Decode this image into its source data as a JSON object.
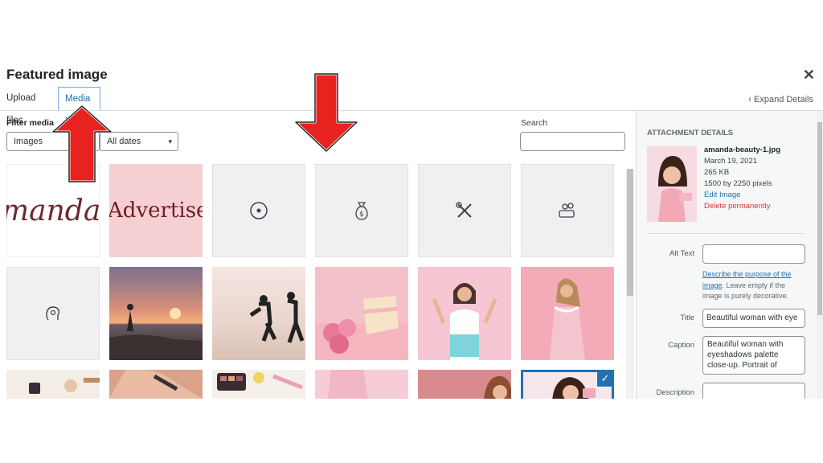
{
  "modal": {
    "title": "Featured image",
    "close_icon": "close-icon",
    "tabs": [
      {
        "label": "Upload files",
        "active": false
      },
      {
        "label": "Media Library",
        "active": true
      }
    ],
    "expand_details": "Expand Details"
  },
  "filters": {
    "label": "Filter media",
    "type_value": "Images",
    "date_value": "All dates",
    "search_label": "Search",
    "search_value": ""
  },
  "grid": {
    "row1": [
      {
        "kind": "image",
        "label": "amanda-logo",
        "text": "manda Ce"
      },
      {
        "kind": "image",
        "label": "advertise-banner",
        "text": "Advertise"
      },
      {
        "kind": "icon",
        "icon": "target-icon"
      },
      {
        "kind": "icon",
        "icon": "money-bag-icon"
      },
      {
        "kind": "icon",
        "icon": "tools-icon"
      },
      {
        "kind": "icon",
        "icon": "hand-coins-icon"
      }
    ],
    "row2": [
      {
        "kind": "icon",
        "icon": "head-icon"
      },
      {
        "kind": "image",
        "label": "yoga-sunset"
      },
      {
        "kind": "image",
        "label": "runners-beach"
      },
      {
        "kind": "image",
        "label": "pink-cake"
      },
      {
        "kind": "image",
        "label": "woman-with-cake"
      },
      {
        "kind": "image",
        "label": "woman-pink-dress"
      }
    ],
    "row3": [
      {
        "kind": "image",
        "label": "makeup-flatlay"
      },
      {
        "kind": "image",
        "label": "face-brush"
      },
      {
        "kind": "image",
        "label": "eyeshadow-palette"
      },
      {
        "kind": "image",
        "label": "pink-shirt"
      },
      {
        "kind": "image",
        "label": "woman-portrait"
      },
      {
        "kind": "image",
        "label": "amanda-beauty-selected",
        "selected": true
      }
    ]
  },
  "attachment": {
    "heading": "Attachment Details",
    "filename": "amanda-beauty-1.jpg",
    "date": "March 19, 2021",
    "size": "265 KB",
    "dimensions": "1500 by 2250 pixels",
    "edit_link": "Edit Image",
    "delete_link": "Delete permanently",
    "alt_text_label": "Alt Text",
    "alt_text_value": "",
    "help_link": "Describe the purpose of the image",
    "help_rest": ". Leave empty if the image is purely decorative.",
    "title_label": "Title",
    "title_value": "Beautiful woman with eye",
    "caption_label": "Caption",
    "caption_value": "Beautiful woman with eyeshadows palette close-up. Portrait of",
    "description_label": "Description",
    "description_value": ""
  },
  "colors": {
    "accent": "#2271b1",
    "delete": "#d63638",
    "arrow": "#e8231f"
  }
}
